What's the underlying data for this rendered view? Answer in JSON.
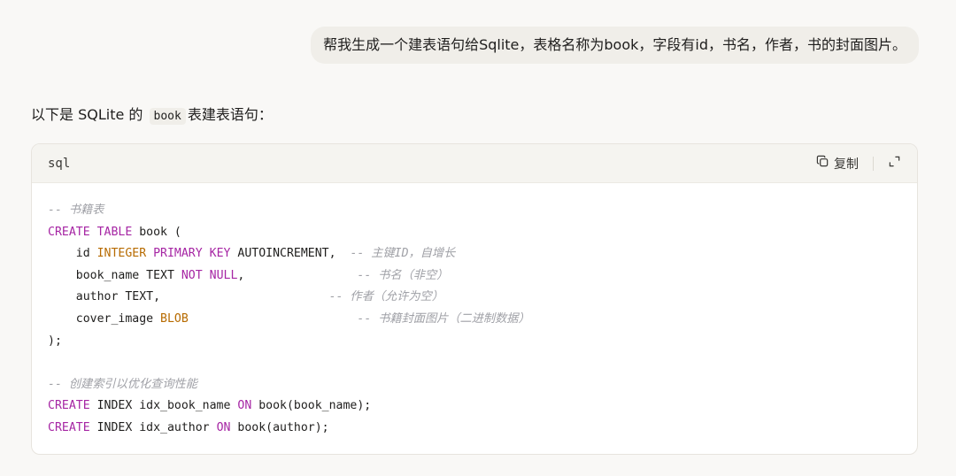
{
  "user_message": "帮我生成一个建表语句给Sqlite，表格名称为book，字段有id，书名，作者，书的封面图片。",
  "assistant": {
    "intro_before": "以下是 SQLite 的",
    "intro_code": "book",
    "intro_after": "表建表语句："
  },
  "code_block": {
    "language": "sql",
    "copy_label": "复制",
    "icons": {
      "copy": "copy-icon",
      "expand": "expand-icon"
    },
    "colors": {
      "keyword": "#a626a4",
      "type": "#b76b01",
      "comment": "#a0a1a7"
    },
    "lines": [
      [
        {
          "t": "cm",
          "s": "-- 书籍表"
        }
      ],
      [
        {
          "t": "kw",
          "s": "CREATE"
        },
        {
          "t": "",
          "s": " "
        },
        {
          "t": "kw",
          "s": "TABLE"
        },
        {
          "t": "",
          "s": " book ("
        }
      ],
      [
        {
          "t": "",
          "s": "    id "
        },
        {
          "t": "ty",
          "s": "INTEGER"
        },
        {
          "t": "",
          "s": " "
        },
        {
          "t": "kw",
          "s": "PRIMARY"
        },
        {
          "t": "",
          "s": " "
        },
        {
          "t": "kw",
          "s": "KEY"
        },
        {
          "t": "",
          "s": " AUTOINCREMENT,  "
        },
        {
          "t": "cm",
          "s": "-- 主键ID，自增长"
        }
      ],
      [
        {
          "t": "",
          "s": "    book_name TEXT "
        },
        {
          "t": "kw",
          "s": "NOT"
        },
        {
          "t": "",
          "s": " "
        },
        {
          "t": "kw",
          "s": "NULL"
        },
        {
          "t": "",
          "s": ",                "
        },
        {
          "t": "cm",
          "s": "-- 书名（非空）"
        }
      ],
      [
        {
          "t": "",
          "s": "    author TEXT,                        "
        },
        {
          "t": "cm",
          "s": "-- 作者（允许为空）"
        }
      ],
      [
        {
          "t": "",
          "s": "    cover_image "
        },
        {
          "t": "ty",
          "s": "BLOB"
        },
        {
          "t": "",
          "s": "                        "
        },
        {
          "t": "cm",
          "s": "-- 书籍封面图片（二进制数据）"
        }
      ],
      [
        {
          "t": "",
          "s": ");"
        }
      ],
      [
        {
          "t": "",
          "s": ""
        }
      ],
      [
        {
          "t": "cm",
          "s": "-- 创建索引以优化查询性能"
        }
      ],
      [
        {
          "t": "kw",
          "s": "CREATE"
        },
        {
          "t": "",
          "s": " INDEX idx_book_name "
        },
        {
          "t": "kw",
          "s": "ON"
        },
        {
          "t": "",
          "s": " book(book_name);"
        }
      ],
      [
        {
          "t": "kw",
          "s": "CREATE"
        },
        {
          "t": "",
          "s": " INDEX idx_author "
        },
        {
          "t": "kw",
          "s": "ON"
        },
        {
          "t": "",
          "s": " book(author);"
        }
      ]
    ]
  }
}
